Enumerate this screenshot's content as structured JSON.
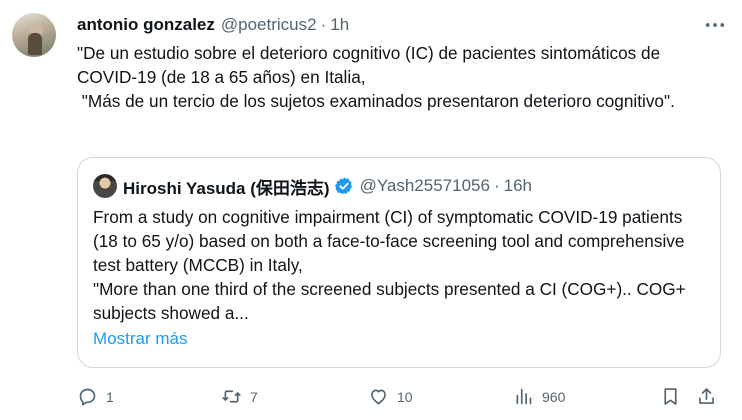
{
  "tweet": {
    "author_name": "antonio gonzalez",
    "author_handle": "@poetricus2",
    "separator": "·",
    "time": "1h",
    "text_lines": [
      "\"De un estudio sobre el deterioro cognitivo (IC) de pacientes sintomáticos de COVID-19 (de 18 a 65 años) en Italia,",
      " \"Más de un tercio de los sujetos examinados presentaron deterioro cognitivo\"."
    ]
  },
  "quoted": {
    "author_name": "Hiroshi Yasuda (保田浩志)",
    "author_handle": "@Yash25571056",
    "separator": "·",
    "time": "16h",
    "text_lines": [
      "From a study on cognitive impairment (CI) of symptomatic COVID-19 patients (18 to 65 y/o) based on both a face-to-face screening tool and comprehensive test battery (MCCB) in Italy,",
      "\"More than one third of the screened subjects presented a CI (COG+).. COG+ subjects showed a..."
    ],
    "show_more": "Mostrar más"
  },
  "actions": {
    "reply_count": "1",
    "repost_count": "7",
    "like_count": "10",
    "views_count": "960"
  },
  "colors": {
    "text": "#0f1419",
    "secondary": "#536471",
    "link": "#1d9bf0",
    "border": "#cfd9de"
  },
  "icons": [
    "more-icon",
    "verified-icon",
    "reply-icon",
    "repost-icon",
    "like-icon",
    "views-icon",
    "bookmark-icon",
    "share-icon"
  ]
}
